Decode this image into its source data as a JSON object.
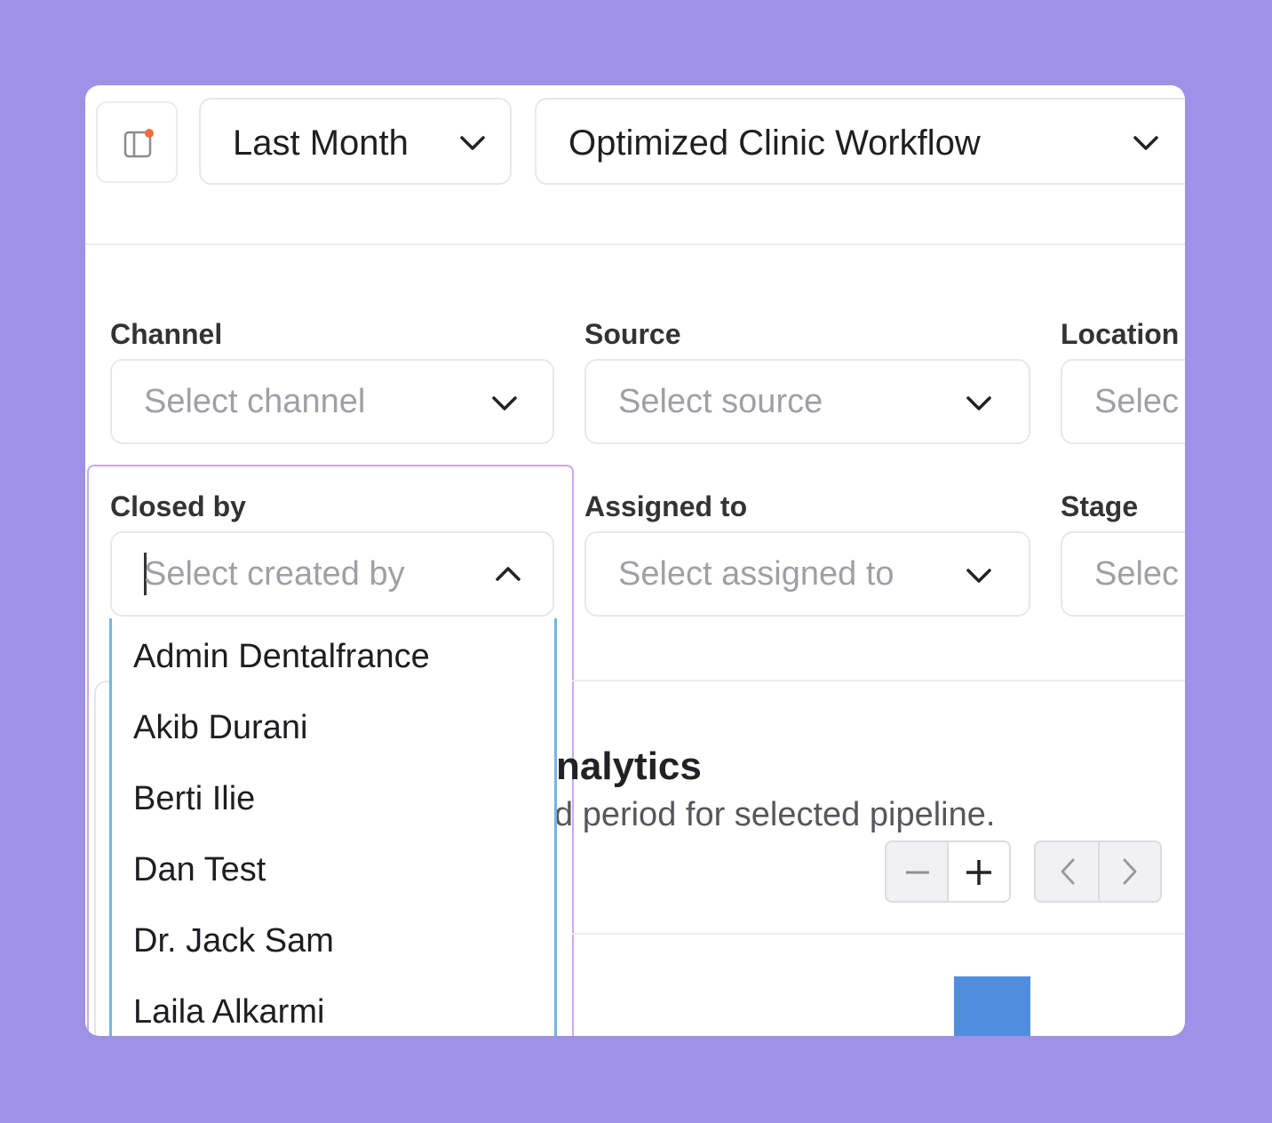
{
  "toolbar": {
    "sidebar_toggle_icon": "sidebar-panel-icon",
    "period_select": {
      "value": "Last Month"
    },
    "pipeline_select": {
      "value": "Optimized Clinic Workflow"
    }
  },
  "filters": {
    "channel": {
      "label": "Channel",
      "placeholder": "Select channel"
    },
    "source": {
      "label": "Source",
      "placeholder": "Select source"
    },
    "location": {
      "label": "Location",
      "placeholder": "Selec"
    },
    "closed_by": {
      "label": "Closed by",
      "placeholder": "Select created by"
    },
    "assigned_to": {
      "label": "Assigned to",
      "placeholder": "Select assigned to"
    },
    "stage": {
      "label": "Stage",
      "placeholder": "Selec"
    }
  },
  "closed_by_options": [
    "Admin Dentalfrance",
    "Akib Durani",
    "Berti Ilie",
    "Dan Test",
    "Dr. Jack Sam",
    "Laila Alkarmi"
  ],
  "analytics": {
    "title": "nalytics",
    "subtitle": "d period for selected pipeline."
  },
  "controls": {
    "zoom_out_icon": "minus-icon",
    "zoom_in_icon": "plus-icon",
    "prev_icon": "chevron-left-icon",
    "next_icon": "chevron-right-icon"
  },
  "colors": {
    "background": "#9f91e6",
    "focus_border": "#c9a8f0",
    "dropdown_border": "#74b6e0",
    "bar": "#4f8ede",
    "sidebar_dot": "#f26b3a"
  }
}
